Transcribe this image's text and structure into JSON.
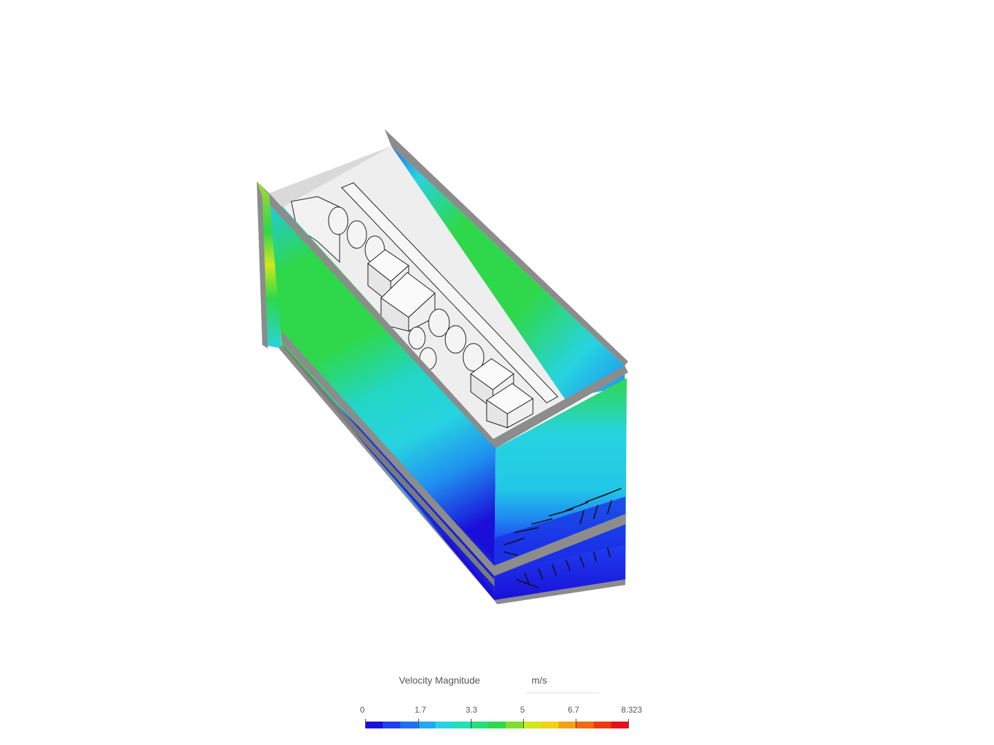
{
  "viewer": {
    "background": "#ffffff"
  },
  "legend": {
    "title": "Velocity Magnitude",
    "unit": "m/s",
    "ticks": [
      "0",
      "1.7",
      "3.3",
      "5",
      "6.7",
      "8.323"
    ],
    "min": 0,
    "max": 8.323,
    "colormap": [
      "#1a0fd8",
      "#1f3ff0",
      "#1f6ff5",
      "#22a7f0",
      "#27d3e0",
      "#22e0b4",
      "#24e07a",
      "#2ed84a",
      "#7ee02a",
      "#d0e81e",
      "#f0d21a",
      "#f4a016",
      "#f06a12",
      "#ec3a10",
      "#e8101c"
    ]
  },
  "model": {
    "wall_color": "#8c8c8c",
    "inner_wall_color": "#d9d9d9",
    "component_color": "#f2f2f2",
    "outline_color": "#1a1a1a"
  }
}
